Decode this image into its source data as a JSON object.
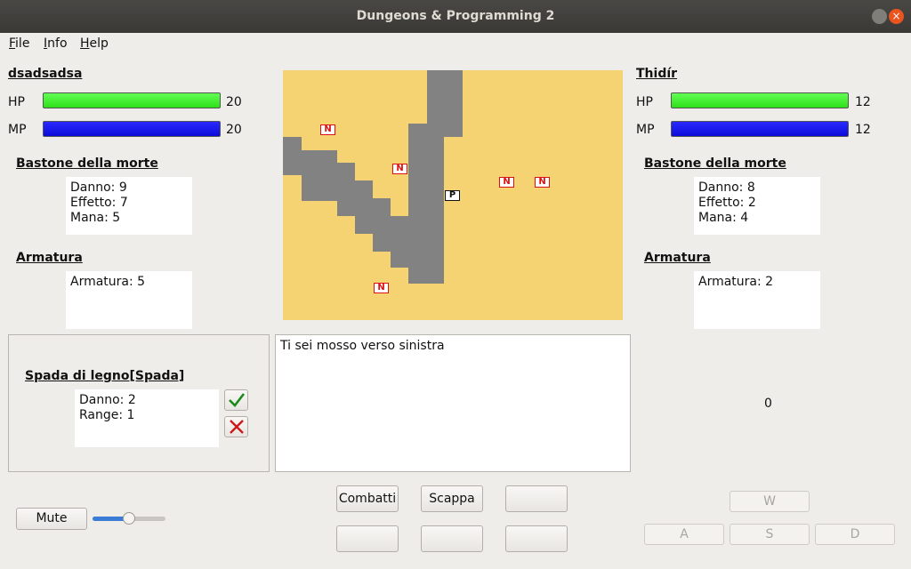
{
  "window": {
    "title": "Dungeons & Programming 2",
    "close_glyph": "×"
  },
  "menu": [
    "File",
    "Info",
    "Help"
  ],
  "player": {
    "name": "dsadsadsa",
    "hp_label": "HP",
    "hp": 20,
    "hp_fill": 1.0,
    "mp_label": "MP",
    "mp": 20,
    "mp_fill": 1.0,
    "weapon": {
      "title": "Bastone della morte",
      "lines": [
        "Danno: 9",
        "Effetto: 7",
        "Mana: 5"
      ]
    },
    "armor": {
      "title": "Armatura",
      "lines": [
        "Armatura: 5"
      ]
    }
  },
  "enemy": {
    "name": "Thidír",
    "hp_label": "HP",
    "hp": 12,
    "hp_fill": 1.0,
    "mp_label": "MP",
    "mp": 12,
    "mp_fill": 1.0,
    "weapon": {
      "title": "Bastone della morte",
      "lines": [
        "Danno: 8",
        "Effetto: 2",
        "Mana: 4"
      ]
    },
    "armor": {
      "title": "Armatura",
      "lines": [
        "Armatura: 2"
      ]
    }
  },
  "item": {
    "title": "Spada di legno[Spada]",
    "lines": [
      "Danno: 2",
      "Range: 1"
    ],
    "accept_icon": "check-icon",
    "reject_icon": "x-icon"
  },
  "log": "Ti sei mosso verso sinistra",
  "counter": "0",
  "map": {
    "ground_color": "#f5d372",
    "wall_color": "#828282",
    "tokens": [
      {
        "label": "N",
        "kind": "enemy"
      },
      {
        "label": "N",
        "kind": "enemy"
      },
      {
        "label": "P",
        "kind": "player"
      },
      {
        "label": "N",
        "kind": "enemy"
      },
      {
        "label": "N",
        "kind": "enemy"
      },
      {
        "label": "N",
        "kind": "enemy"
      }
    ]
  },
  "actions": {
    "fight": "Combatti",
    "flee": "Scappa"
  },
  "controls": {
    "mute": "Mute",
    "volume": 0.5
  },
  "dpad": {
    "up": "W",
    "left": "A",
    "down": "S",
    "right": "D"
  }
}
